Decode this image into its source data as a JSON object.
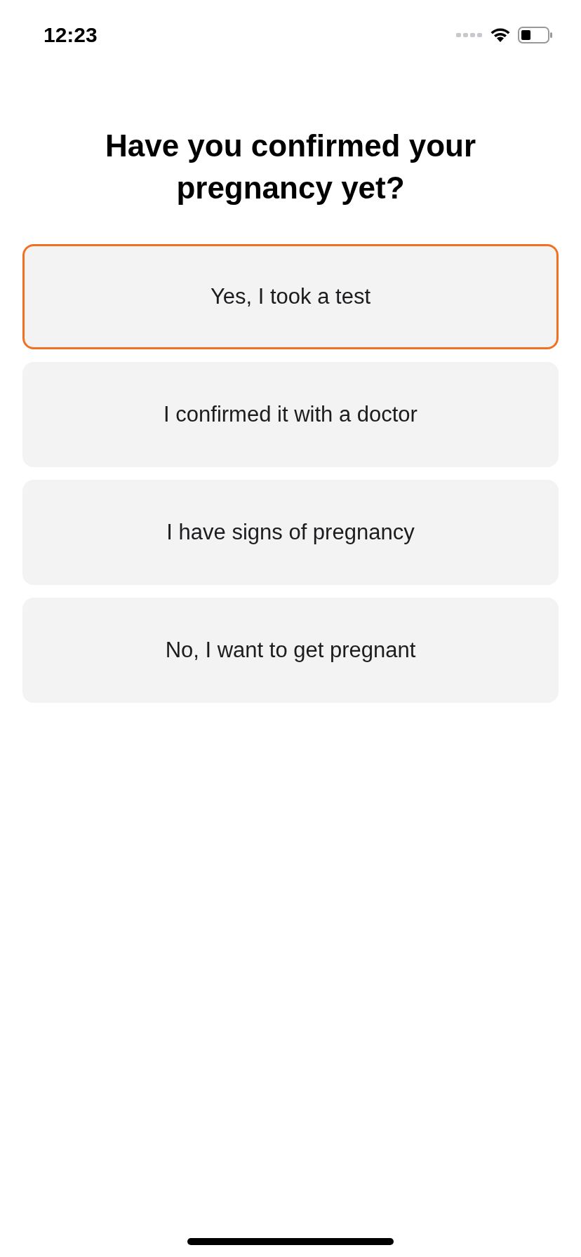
{
  "status_bar": {
    "time": "12:23"
  },
  "question": "Have you confirmed your pregnancy yet?",
  "options": [
    {
      "label": "Yes, I took a test",
      "selected": true
    },
    {
      "label": "I confirmed it with a doctor",
      "selected": false
    },
    {
      "label": "I have signs of pregnancy",
      "selected": false
    },
    {
      "label": "No, I want to get pregnant",
      "selected": false
    }
  ]
}
